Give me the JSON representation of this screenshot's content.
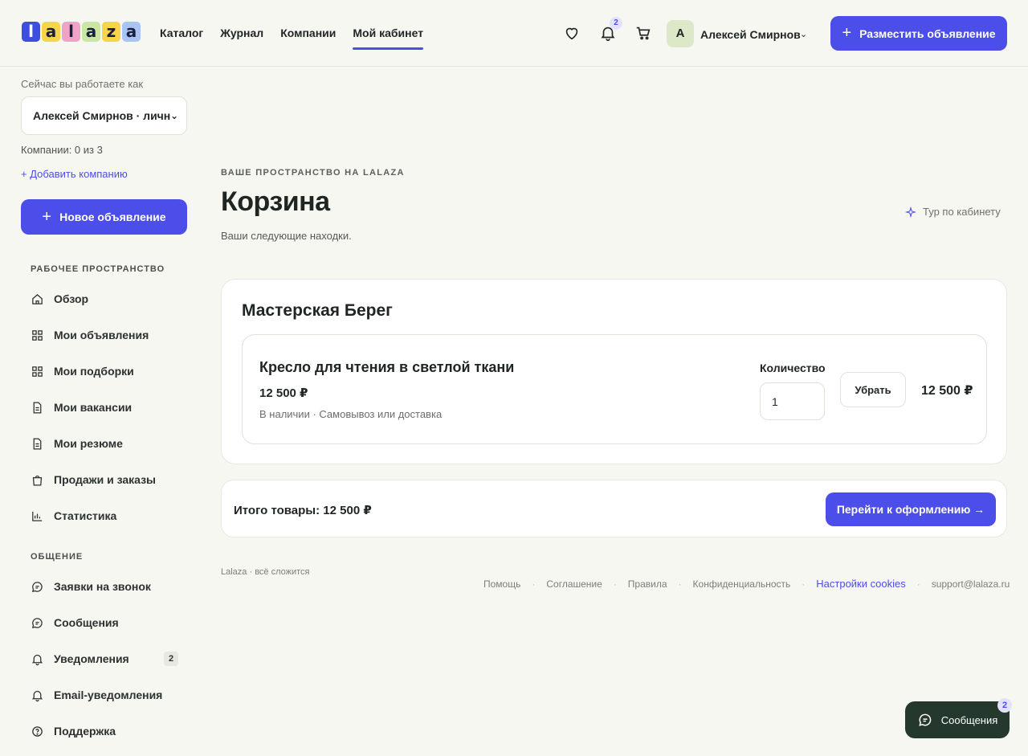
{
  "header": {
    "logo_letters": [
      "l",
      "a",
      "l",
      "a",
      "z",
      "a"
    ],
    "logo_colors": [
      "#3d4fe0",
      "#f6d54b",
      "#f1a3c7",
      "#c9e6a3",
      "#f6d54b",
      "#a9c3f5"
    ],
    "nav": [
      {
        "label": "Каталог",
        "active": false
      },
      {
        "label": "Журнал",
        "active": false
      },
      {
        "label": "Компании",
        "active": false
      },
      {
        "label": "Мой кабинет",
        "active": true
      }
    ],
    "icons": [
      "heart-icon",
      "bell-icon",
      "cart-icon"
    ],
    "notifications_count": "2",
    "avatar_letter": "А",
    "user_name": "Алексей Смирнов",
    "post_button": "Разместить объявление"
  },
  "sidebar": {
    "working_as_label": "Сейчас вы работаете как",
    "account_select": "Алексей Смирнов · личн",
    "companies_count": "Компании: 0 из 3",
    "add_company": "+ Добавить компанию",
    "new_ad_button": "Новое объявление",
    "workspace_title": "РАБОЧЕЕ ПРОСТРАНСТВО",
    "workspace_items": [
      {
        "label": "Обзор",
        "icon": "home-icon"
      },
      {
        "label": "Мои объявления",
        "icon": "grid-icon"
      },
      {
        "label": "Мои подборки",
        "icon": "grid-icon"
      },
      {
        "label": "Мои вакансии",
        "icon": "document-icon"
      },
      {
        "label": "Мои резюме",
        "icon": "document-icon"
      },
      {
        "label": "Продажи и заказы",
        "icon": "bag-icon"
      },
      {
        "label": "Статистика",
        "icon": "chart-icon"
      }
    ],
    "communication_title": "ОБЩЕНИЕ",
    "communication_items": [
      {
        "label": "Заявки на звонок",
        "icon": "chat-icon"
      },
      {
        "label": "Сообщения",
        "icon": "chat-icon"
      },
      {
        "label": "Уведомления",
        "icon": "bell-icon",
        "badge": "2"
      },
      {
        "label": "Email-уведомления",
        "icon": "bell-icon"
      },
      {
        "label": "Поддержка",
        "icon": "help-icon"
      }
    ]
  },
  "main": {
    "eyebrow": "ВАШЕ ПРОСТРАНСТВО НА LALAZA",
    "title": "Корзина",
    "subtitle": "Ваши следующие находки.",
    "tour_link": "Тур по кабинету",
    "seller": {
      "name": "Мастерская Берег",
      "item": {
        "title": "Кресло для чтения в светлой ткани",
        "price": "12 500 ₽",
        "meta": "В наличии · Самовывоз или доставка",
        "quantity_label": "Количество",
        "quantity_value": "1",
        "remove_button": "Убрать",
        "line_total": "12 500 ₽"
      }
    },
    "total_text": "Итого товары: 12 500 ₽",
    "checkout_button": "Перейти к оформлению →"
  },
  "footer": {
    "brand": "Lalaza · всё сложится",
    "links": [
      "Помощь",
      "Соглашение",
      "Правила",
      "Конфиденциальность"
    ],
    "cookies_link": "Настройки cookies",
    "email": "support@lalaza.ru"
  },
  "chat_fab": {
    "label": "Сообщения",
    "badge": "2"
  },
  "colors": {
    "accent": "#4b4ee8",
    "background": "#f7f7f2",
    "fab": "#24382e"
  }
}
